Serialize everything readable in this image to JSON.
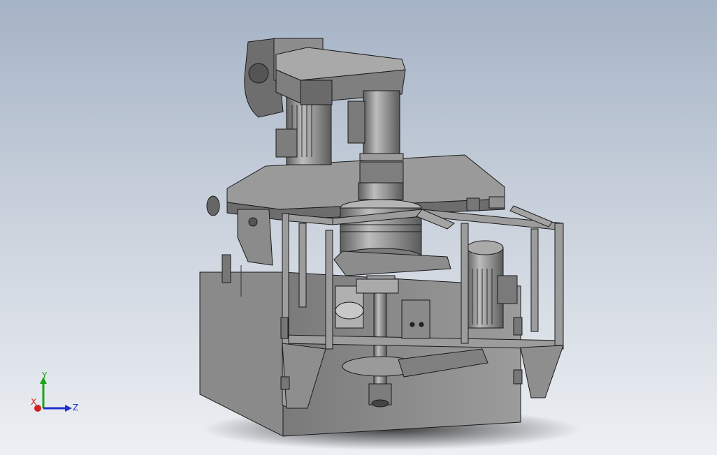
{
  "scene": {
    "background_top": "#a5b3c6",
    "background_bottom": "#edf0f4",
    "model_body_color": "#8e8e8e",
    "edge_color": "#1a1a1a"
  },
  "triad": {
    "y_label": "Y",
    "x_label": "X",
    "z_label": "Z",
    "y_color": "#1aa31a",
    "x_color": "#d42020",
    "z_color": "#2030c8"
  }
}
